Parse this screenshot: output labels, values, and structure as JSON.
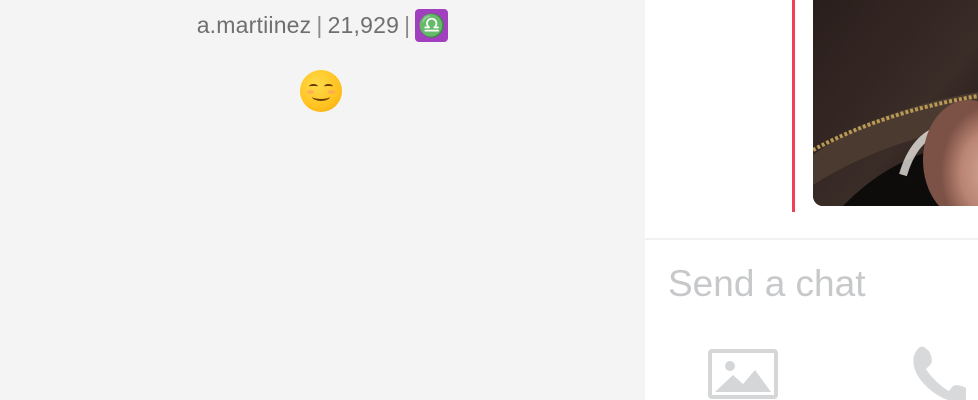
{
  "profile": {
    "username": "a.martiinez",
    "separator": "|",
    "score": "21,929",
    "zodiac_symbol": "♎",
    "zodiac_color": "#a23fbe",
    "emoji": "smiling-face-icon"
  },
  "chat": {
    "message_bar_color": "#ef4056",
    "input_placeholder": "Send a chat",
    "photo_icon": "image-icon",
    "call_icon": "phone-icon"
  }
}
